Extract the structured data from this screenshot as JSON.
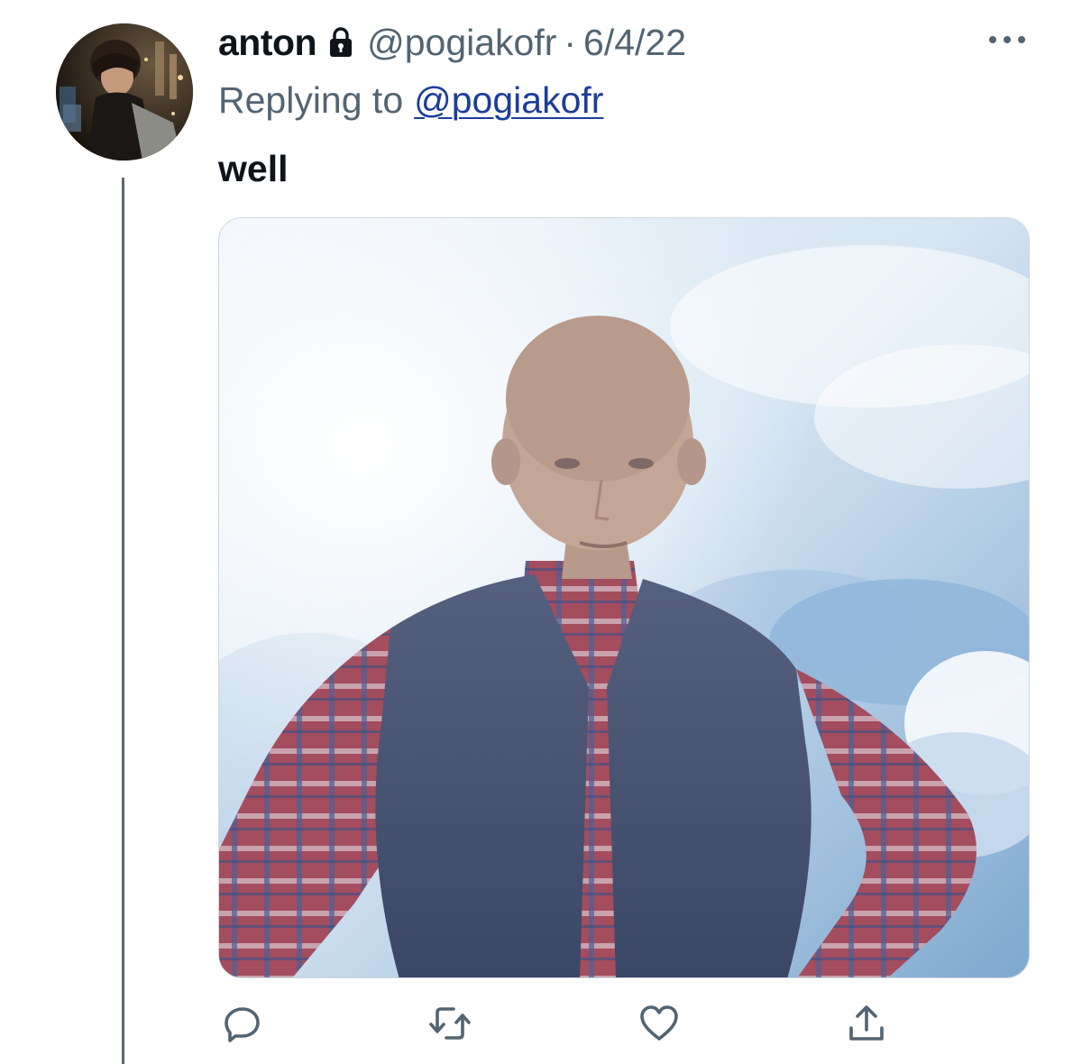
{
  "tweet": {
    "display_name": "anton",
    "protected_icon": "lock-icon",
    "handle": "@pogiakofr",
    "separator": "·",
    "date": "6/4/22",
    "replying_prefix": "Replying to",
    "replying_to": "@pogiakofr",
    "text": "well",
    "more_icon": "more-horizontal-icon"
  },
  "media": {
    "description_icon": "tweet-image",
    "sky_color": "#b9d3ea",
    "shirt_color": "#9a4a5a",
    "vest_color": "#4d5a78"
  },
  "actions": [
    {
      "name": "reply",
      "icon": "reply-icon"
    },
    {
      "name": "retweet",
      "icon": "retweet-icon"
    },
    {
      "name": "like",
      "icon": "heart-icon"
    },
    {
      "name": "share",
      "icon": "share-icon"
    }
  ],
  "colors": {
    "text_primary": "#0f1419",
    "text_secondary": "#536471",
    "link": "#1d3d9a",
    "thread_line": "#5f6670"
  }
}
